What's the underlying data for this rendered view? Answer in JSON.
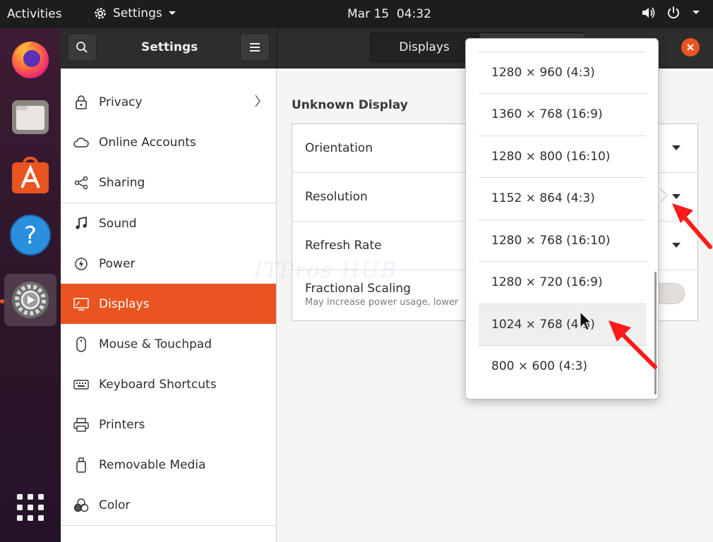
{
  "topbar": {
    "activities": "Activities",
    "app_name": "Settings",
    "clock": "Mar 15  04:32"
  },
  "dock": {
    "items": [
      "firefox-icon",
      "files-icon",
      "software-icon",
      "help-icon",
      "settings-icon",
      "app-grid-icon"
    ]
  },
  "window": {
    "title": "Settings",
    "tabs": [
      "Displays",
      ""
    ]
  },
  "sidebar": {
    "items": [
      {
        "label": "Privacy",
        "icon": "lock-icon"
      },
      {
        "label": "Online Accounts",
        "icon": "cloud-icon"
      },
      {
        "label": "Sharing",
        "icon": "share-icon"
      },
      {
        "label": "Sound",
        "icon": "music-note-icon"
      },
      {
        "label": "Power",
        "icon": "power-icon"
      },
      {
        "label": "Displays",
        "icon": "display-icon"
      },
      {
        "label": "Mouse & Touchpad",
        "icon": "mouse-icon"
      },
      {
        "label": "Keyboard Shortcuts",
        "icon": "keyboard-icon"
      },
      {
        "label": "Printers",
        "icon": "printer-icon"
      },
      {
        "label": "Removable Media",
        "icon": "usb-drive-icon"
      },
      {
        "label": "Color",
        "icon": "color-icon"
      }
    ],
    "selected": "Displays"
  },
  "content": {
    "display_name": "Unknown Display",
    "rows": {
      "orientation": "Orientation",
      "resolution": "Resolution",
      "refresh_rate": "Refresh Rate",
      "fractional_scaling": "Fractional Scaling",
      "fractional_scaling_sub": "May increase power usage, lower"
    }
  },
  "watermark": "ITPros HUB",
  "resolution_menu": {
    "options": [
      "1280 × 960 (4:3)",
      "1360 × 768 (16:9)",
      "1280 × 800 (16:10)",
      "1152 × 864 (4:3)",
      "1280 × 768 (16:10)",
      "1280 × 720 (16:9)",
      "1024 × 768 (4:3)",
      "800 × 600 (4:3)"
    ],
    "hovered": "1024 × 768 (4:3)"
  },
  "colors": {
    "accent": "#e95420",
    "annotation": "#ff1a1a"
  }
}
